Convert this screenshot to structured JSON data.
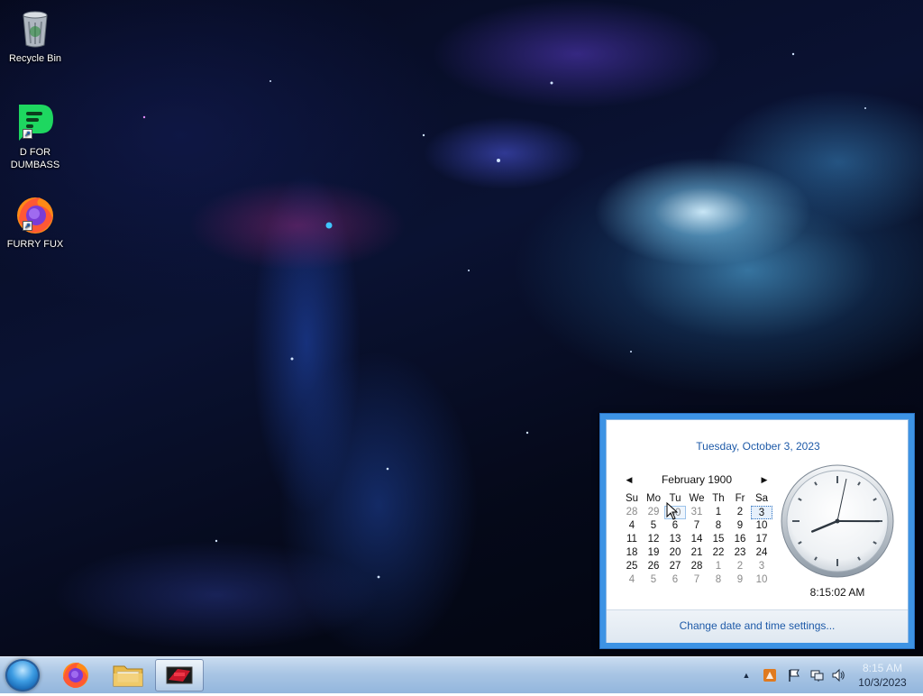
{
  "desktop": {
    "icons": [
      {
        "label": "Recycle Bin",
        "icon": "recycle-bin-icon"
      },
      {
        "label": "D FOR\nDUMBASS",
        "icon": "green-chat-app-icon"
      },
      {
        "label": "FURRY FUX",
        "icon": "firefox-icon"
      }
    ]
  },
  "taskbar": {
    "start_icon": "windows-orb-icon",
    "pinned": [
      {
        "name": "Firefox",
        "icon": "firefox-icon"
      },
      {
        "name": "File Explorer",
        "icon": "folder-icon"
      },
      {
        "name": "Media App",
        "icon": "media-app-icon",
        "active": true
      }
    ],
    "tray": {
      "show_hidden_symbol": "▲",
      "icons": [
        "notification-app-icon",
        "action-center-flag-icon",
        "network-icon",
        "volume-icon"
      ],
      "time": "8:15 AM",
      "date": "10/3/2023"
    }
  },
  "calendar_popup": {
    "full_date": "Tuesday, October 3, 2023",
    "month_label": "February 1900",
    "prev_symbol": "◀",
    "next_symbol": "▶",
    "weekdays": [
      "Su",
      "Mo",
      "Tu",
      "We",
      "Th",
      "Fr",
      "Sa"
    ],
    "weeks": [
      [
        "28",
        "29",
        "30",
        "31",
        "1",
        "2",
        "3"
      ],
      [
        "4",
        "5",
        "6",
        "7",
        "8",
        "9",
        "10"
      ],
      [
        "11",
        "12",
        "13",
        "14",
        "15",
        "16",
        "17"
      ],
      [
        "18",
        "19",
        "20",
        "21",
        "22",
        "23",
        "24"
      ],
      [
        "25",
        "26",
        "27",
        "28",
        "1",
        "2",
        "3"
      ],
      [
        "4",
        "5",
        "6",
        "7",
        "8",
        "9",
        "10"
      ]
    ],
    "clock": {
      "hours": 8,
      "minutes": 15,
      "seconds": 2
    },
    "digital_time": "8:15:02 AM",
    "change_link": "Change date and time settings..."
  },
  "colors": {
    "accent": "#3d93e4",
    "link": "#1e5aa8"
  }
}
